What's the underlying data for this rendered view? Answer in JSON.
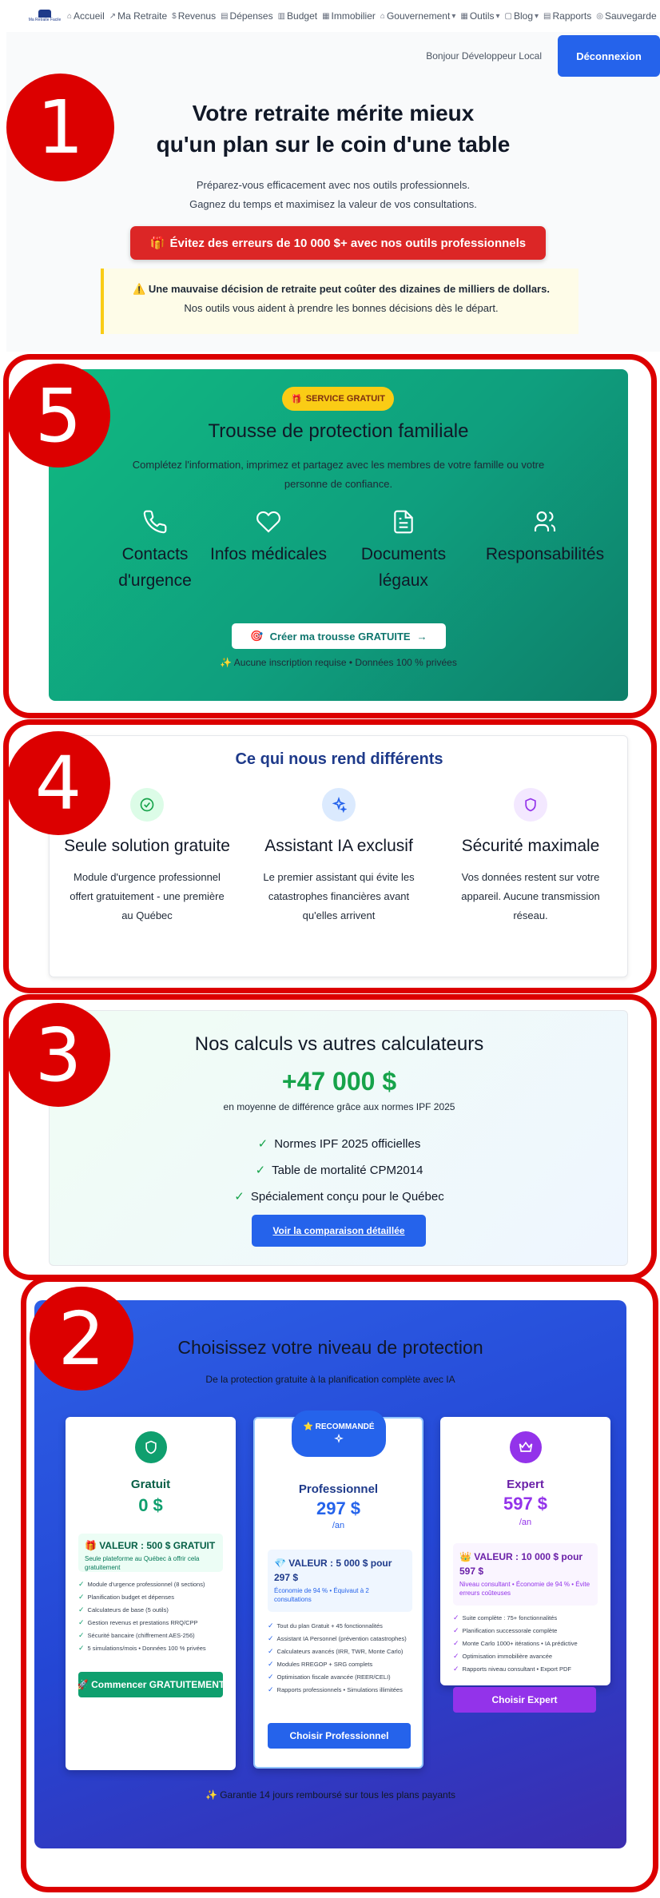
{
  "nav": {
    "logo_text": "Ma Retraite Facile",
    "items": [
      {
        "icon": "home-icon",
        "glyph": "⌂",
        "label": "Accueil"
      },
      {
        "icon": "chart-line-icon",
        "glyph": "↗",
        "label": "Ma Retraite"
      },
      {
        "icon": "dollar-icon",
        "glyph": "$",
        "label": "Revenus"
      },
      {
        "icon": "receipt-icon",
        "glyph": "▤",
        "label": "Dépenses"
      },
      {
        "icon": "bar-chart-icon",
        "glyph": "▥",
        "label": "Budget"
      },
      {
        "icon": "building-icon",
        "glyph": "▦",
        "label": "Immobilier"
      },
      {
        "icon": "landmark-icon",
        "glyph": "⌂",
        "label": "Gouvernement",
        "caret": "▾"
      },
      {
        "icon": "grid-icon",
        "glyph": "▦",
        "label": "Outils",
        "caret": "▾"
      },
      {
        "icon": "book-icon",
        "glyph": "▢",
        "label": "Blog",
        "caret": "▾"
      },
      {
        "icon": "file-chart-icon",
        "glyph": "▤",
        "label": "Rapports"
      },
      {
        "icon": "save-icon",
        "glyph": "◎",
        "label": "Sauvegarde"
      }
    ]
  },
  "topbar": {
    "greeting": "Bonjour Développeur Local",
    "logout": "Déconnexion"
  },
  "hero": {
    "title_line1": "Votre retraite mérite mieux",
    "title_line2": "qu'un plan sur le coin d'une table",
    "line1": "Préparez-vous efficacement avec nos outils professionnels.",
    "line2": "Gagnez du temps et maximisez la valeur de vos consultations.",
    "cta_icon": "🎁",
    "cta": "Évitez des erreurs de 10 000 $+ avec nos outils professionnels",
    "warning_icon": "⚠️",
    "warning_line1": "Une mauvaise décision de retraite peut coûter des dizaines de milliers de dollars.",
    "warning_line2": "Nos outils vous aident à prendre les bonnes décisions dès le départ."
  },
  "annotations": [
    "1",
    "5",
    "4",
    "3",
    "2"
  ],
  "family_kit": {
    "badge_icon": "🎁",
    "badge": "SERVICE GRATUIT",
    "title": "Trousse de protection familiale",
    "subtitle": "Complétez l'information, imprimez et partagez avec les membres de votre famille ou votre personne de confiance.",
    "features": [
      {
        "icon": "phone-icon",
        "label": "Contacts d'urgence"
      },
      {
        "icon": "heart-icon",
        "label": "Infos médicales"
      },
      {
        "icon": "document-icon",
        "label": "Documents légaux"
      },
      {
        "icon": "users-icon",
        "label": "Responsabilités"
      }
    ],
    "cta_icon": "🎯",
    "cta": "Créer ma trousse GRATUITE",
    "cta_arrow": "→",
    "note": "✨ Aucune inscription requise • Données 100 % privées"
  },
  "differences": {
    "title": "Ce qui nous rend différents",
    "items": [
      {
        "icon": "check-circle-icon",
        "title": "Seule solution gratuite",
        "text": "Module d'urgence professionnel offert gratuitement - une première au Québec"
      },
      {
        "icon": "sparkles-icon",
        "title": "Assistant IA exclusif",
        "text": "Le premier assistant qui évite les catastrophes financières avant qu'elles arrivent"
      },
      {
        "icon": "shield-icon",
        "title": "Sécurité maximale",
        "text": "Vos données restent sur votre appareil. Aucune transmission réseau."
      }
    ]
  },
  "calculations": {
    "title": "Nos calculs vs autres calculateurs",
    "amount": "+47 000 $",
    "subtitle": "en moyenne de différence grâce aux normes IPF 2025",
    "checks": [
      "Normes IPF 2025 officielles",
      "Table de mortalité CPM2014",
      "Spécialement conçu pour le Québec"
    ],
    "check_glyph": "✓",
    "button": "Voir la comparaison détaillée"
  },
  "plans": {
    "title": "Choisissez votre niveau de protection",
    "subtitle": "De la protection gratuite à la planification complète avec IA",
    "free": {
      "name": "Gratuit",
      "price": "0 $",
      "value_title": "🎁 VALEUR : 500 $ GRATUIT",
      "value_sub": "Seule plateforme au Québec à offrir cela gratuitement",
      "features": [
        "Module d'urgence professionnel (8 sections)",
        "Planification budget et dépenses",
        "Calculateurs de base (5 outils)",
        "Gestion revenus et prestations RRQ/CPP",
        "Sécurité bancaire (chiffrement AES-256)",
        "5 simulations/mois • Données 100 % privées"
      ],
      "button": "🚀 Commencer GRATUITEMENT",
      "color": "#0f9f6e"
    },
    "pro": {
      "ribbon": "⭐ RECOMMANDÉ",
      "name": "Professionnel",
      "price": "297 $",
      "period": "/an",
      "value_title": "💎 VALEUR : 5 000 $ pour 297 $",
      "value_sub": "Économie de 94 % • Équivaut à 2 consultations",
      "features": [
        "Tout du plan Gratuit + 45 fonctionnalités",
        "Assistant IA Personnel (prévention catastrophes)",
        "Calculateurs avancés (IRR, TWR, Monte Carlo)",
        "Modules RREGOP + SRG complets",
        "Optimisation fiscale avancée (REER/CELI)",
        "Rapports professionnels • Simulations illimitées"
      ],
      "button": "Choisir Professionnel",
      "color": "#2563eb"
    },
    "expert": {
      "name": "Expert",
      "price": "597 $",
      "period": "/an",
      "value_title": "👑 VALEUR : 10 000 $ pour 597 $",
      "value_sub": "Niveau consultant • Économie de 94 % • Évite erreurs coûteuses",
      "features": [
        "Suite complète : 75+ fonctionnalités",
        "Planification successorale complète",
        "Monte Carlo 1000+ itérations • IA prédictive",
        "Optimisation immobilière avancée",
        "Rapports niveau consultant • Export PDF"
      ],
      "button": "Choisir Expert",
      "color": "#9333ea"
    },
    "guarantee": "✨ Garantie 14 jours remboursé sur tous les plans payants"
  }
}
